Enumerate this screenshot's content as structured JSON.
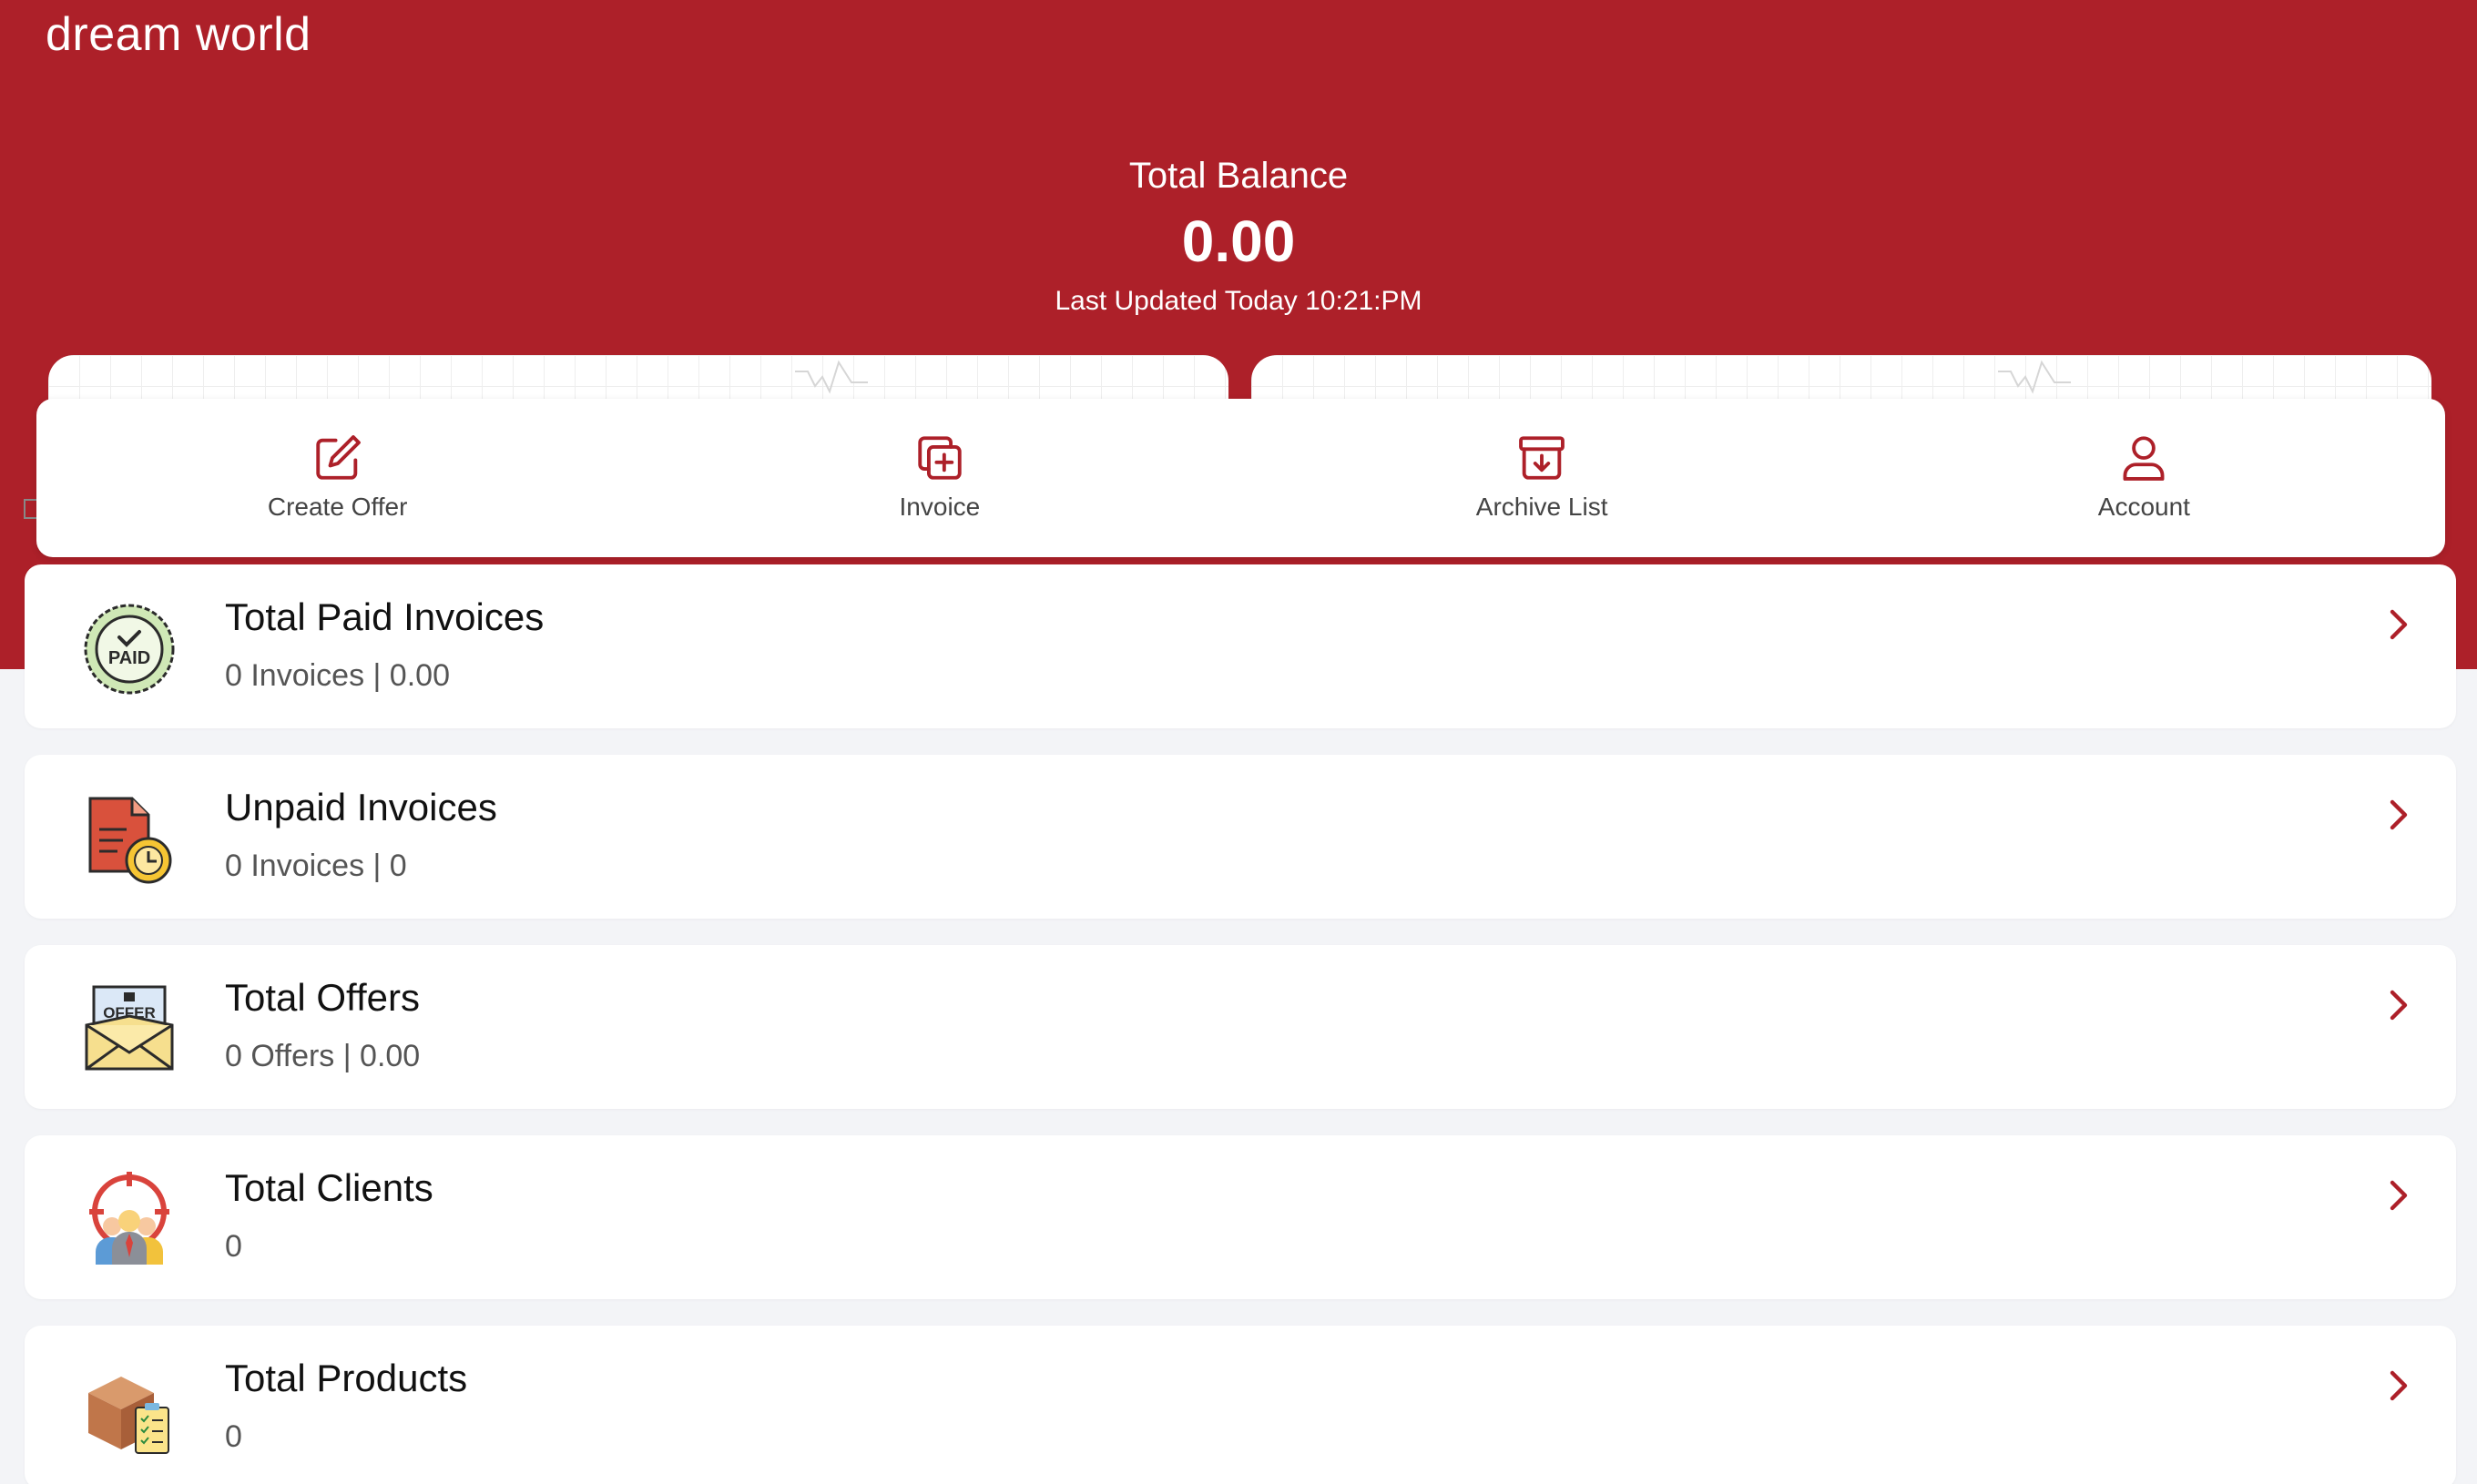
{
  "app": {
    "title": "dream world"
  },
  "balance": {
    "label": "Total Balance",
    "value": "0.00",
    "updated": "Last Updated Today 10:21:PM"
  },
  "quick_actions": [
    {
      "label": "Create Offer",
      "icon": "edit-icon"
    },
    {
      "label": "Invoice",
      "icon": "add-copy-icon"
    },
    {
      "label": "Archive List",
      "icon": "archive-icon"
    },
    {
      "label": "Account",
      "icon": "user-icon"
    }
  ],
  "stats": [
    {
      "title": "Total Paid Invoices",
      "subtitle": "0 Invoices | 0.00",
      "icon": "paid-badge-icon"
    },
    {
      "title": "Unpaid Invoices",
      "subtitle": "0 Invoices | 0",
      "icon": "pending-document-icon"
    },
    {
      "title": "Total Offers",
      "subtitle": "0 Offers | 0.00",
      "icon": "offer-envelope-icon"
    },
    {
      "title": "Total Clients",
      "subtitle": "0",
      "icon": "clients-target-icon"
    },
    {
      "title": "Total Products",
      "subtitle": "0",
      "icon": "product-box-icon"
    }
  ],
  "colors": {
    "brand": "#ad2029",
    "background": "#f3f4f7",
    "card": "#ffffff"
  }
}
